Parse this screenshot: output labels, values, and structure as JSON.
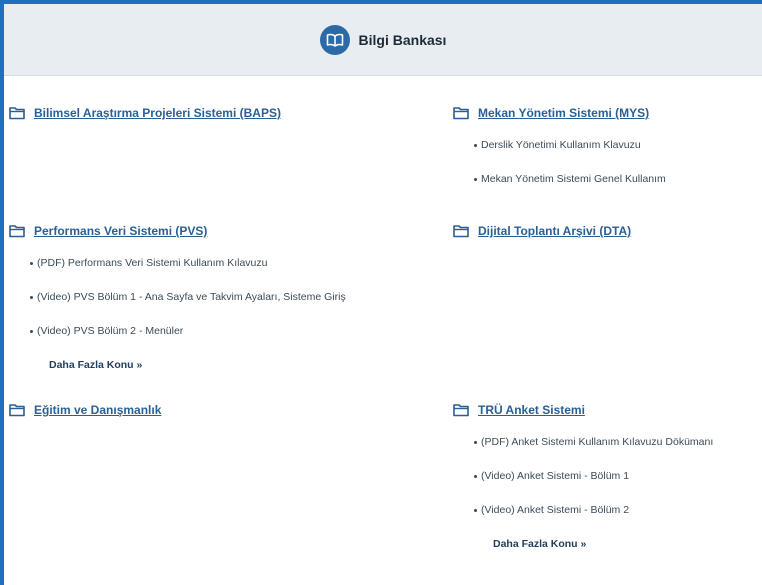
{
  "header": {
    "title": "Bilgi Bankası",
    "icon": "open-book-icon"
  },
  "colors": {
    "border": "#1f6fc0",
    "link": "#2b5f93",
    "header_bg": "#e8edf2",
    "badge": "#2b6aa6"
  },
  "sections": {
    "baps": {
      "title": "Bilimsel Araştırma Projeleri Sistemi (BAPS)"
    },
    "mys": {
      "title": "Mekan Yönetim Sistemi (MYS)",
      "items": [
        "Derslik Yönetimi Kullanım Klavuzu",
        "Mekan Yönetim Sistemi Genel Kullanım"
      ]
    },
    "pvs": {
      "title": "Performans Veri Sistemi (PVS)",
      "items": [
        "(PDF) Performans Veri Sistemi Kullanım Kılavuzu",
        "(Video) PVS Bölüm 1 - Ana Sayfa ve Takvim Ayaları, Sisteme Giriş",
        "(Video) PVS Bölüm 2 - Menüler"
      ],
      "more": "Daha Fazla Konu »"
    },
    "dta": {
      "title": "Dijital Toplantı Arşivi (DTA)"
    },
    "egitim": {
      "title": "Eğitim ve Danışmanlık"
    },
    "anket": {
      "title": "TRÜ Anket Sistemi",
      "items": [
        "(PDF) Anket Sistemi Kullanım Kılavuzu Dökümanı",
        "(Video) Anket Sistemi - Bölüm 1",
        "(Video) Anket Sistemi - Bölüm 2"
      ],
      "more": "Daha Fazla Konu »"
    }
  }
}
